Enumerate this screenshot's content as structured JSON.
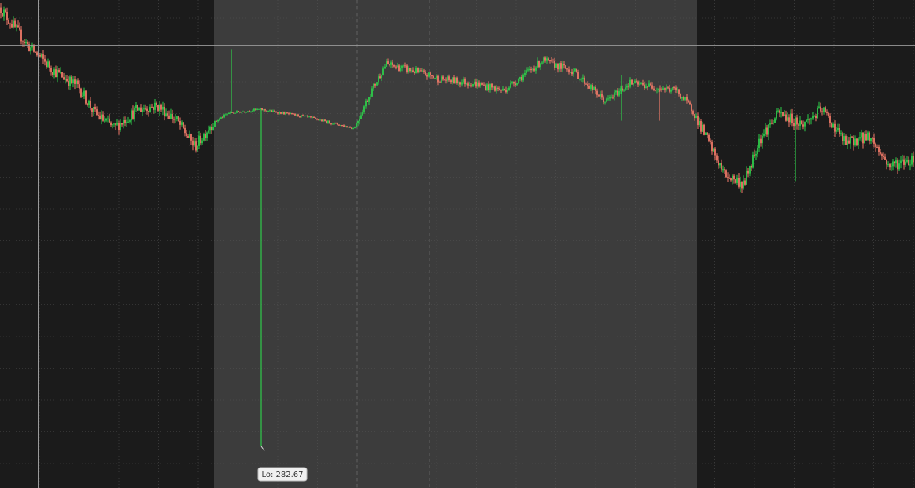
{
  "chart_data": {
    "type": "candlestick",
    "title": "",
    "xlabel": "",
    "ylabel": "",
    "grid": true,
    "ylim": [
      282.0,
      294.5
    ],
    "colors": {
      "background": "#1b1b1b",
      "session_shade": "#3c3c3c",
      "up": "#2ecc4a",
      "down": "#f07a68",
      "gridline": "#5a5a5a",
      "crosshair": "#9a9a9a",
      "label_bg": "#f0f0f0"
    },
    "sessions": [
      {
        "name": "pre-market",
        "shaded": false
      },
      {
        "name": "regular",
        "shaded": true
      },
      {
        "name": "post-market",
        "shaded": false
      }
    ],
    "price_path": [
      {
        "t": 0,
        "p": 294.3
      },
      {
        "t": 35,
        "p": 293.3
      },
      {
        "t": 70,
        "p": 292.6
      },
      {
        "t": 100,
        "p": 292.2
      },
      {
        "t": 120,
        "p": 291.5
      },
      {
        "t": 145,
        "p": 291.1
      },
      {
        "t": 175,
        "p": 291.6
      },
      {
        "t": 200,
        "p": 291.7
      },
      {
        "t": 225,
        "p": 291.3
      },
      {
        "t": 248,
        "p": 290.6
      },
      {
        "t": 268,
        "p": 291.2
      },
      {
        "t": 290,
        "p": 291.5
      },
      {
        "t": 330,
        "p": 291.6
      },
      {
        "t": 390,
        "p": 291.4
      },
      {
        "t": 450,
        "p": 291.1
      },
      {
        "t": 470,
        "p": 292.0
      },
      {
        "t": 490,
        "p": 292.8
      },
      {
        "t": 530,
        "p": 292.6
      },
      {
        "t": 560,
        "p": 292.4
      },
      {
        "t": 600,
        "p": 292.3
      },
      {
        "t": 640,
        "p": 292.1
      },
      {
        "t": 690,
        "p": 292.9
      },
      {
        "t": 730,
        "p": 292.6
      },
      {
        "t": 770,
        "p": 291.8
      },
      {
        "t": 800,
        "p": 292.3
      },
      {
        "t": 860,
        "p": 292.1
      },
      {
        "t": 880,
        "p": 291.6
      },
      {
        "t": 920,
        "p": 289.9
      },
      {
        "t": 945,
        "p": 289.6
      },
      {
        "t": 965,
        "p": 290.8
      },
      {
        "t": 990,
        "p": 291.5
      },
      {
        "t": 1020,
        "p": 291.2
      },
      {
        "t": 1045,
        "p": 291.6
      },
      {
        "t": 1075,
        "p": 290.7
      },
      {
        "t": 1105,
        "p": 290.9
      },
      {
        "t": 1130,
        "p": 290.1
      },
      {
        "t": 1163,
        "p": 290.3
      }
    ],
    "spikes": [
      {
        "t": 294,
        "high": 293.2,
        "low": 291.5,
        "dir": "up"
      },
      {
        "t": 332,
        "high": 291.6,
        "low": 282.67,
        "dir": "up"
      },
      {
        "t": 790,
        "high": 292.5,
        "low": 291.3,
        "dir": "up"
      },
      {
        "t": 838,
        "high": 292.1,
        "low": 291.3,
        "dir": "down"
      },
      {
        "t": 1011,
        "high": 291.2,
        "low": 289.7,
        "dir": "up"
      }
    ],
    "annotations": [
      {
        "type": "low_marker",
        "text": "Lo: 282.67",
        "value": 282.67
      }
    ],
    "crosshair": {
      "price": 293.3
    }
  }
}
